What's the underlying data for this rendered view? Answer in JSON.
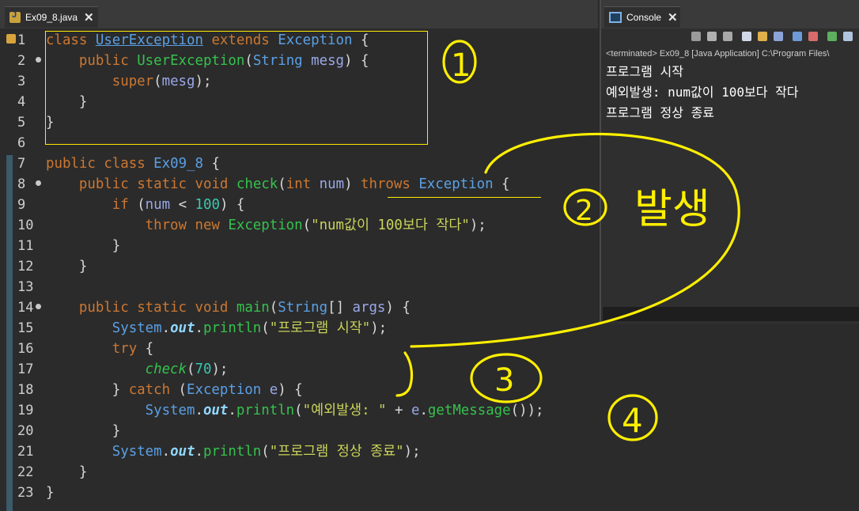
{
  "editor": {
    "tab_label": "Ex09_8.java",
    "lines": [
      "1",
      "2",
      "3",
      "4",
      "5",
      "6",
      "7",
      "8",
      "9",
      "10",
      "11",
      "12",
      "13",
      "14",
      "15",
      "16",
      "17",
      "18",
      "19",
      "20",
      "21",
      "22",
      "23"
    ]
  },
  "console": {
    "tab_label": "Console",
    "header": "<terminated> Ex09_8 [Java Application] C:\\Program Files\\",
    "output": [
      "프로그램 시작",
      "예외발생: num값이 100보다 작다",
      "프로그램 정상 종료"
    ]
  },
  "annotations": {
    "n1": "1",
    "n2": "2",
    "word": "발생",
    "n3": "3",
    "n4": "4",
    "color": "#ffef00"
  }
}
